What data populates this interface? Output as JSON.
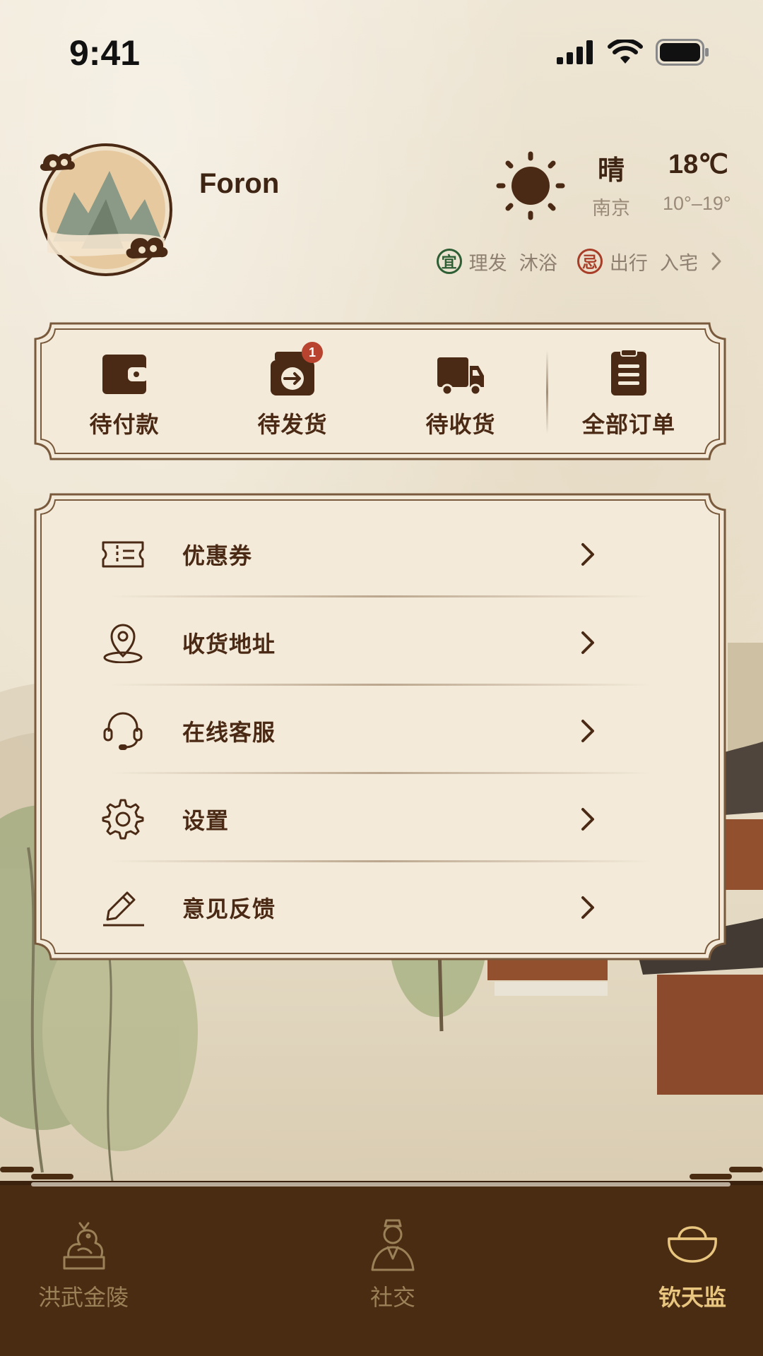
{
  "status_bar": {
    "time": "9:41"
  },
  "profile": {
    "username": "Foron"
  },
  "weather": {
    "condition": "晴",
    "temperature": "18℃",
    "city": "南京",
    "range": "10°–19°"
  },
  "almanac": {
    "yi_badge": "宜",
    "yi_items": "理发  沐浴",
    "ji_badge": "忌",
    "ji_items": "出行  入宅"
  },
  "orders": {
    "items": [
      {
        "label": "待付款",
        "icon": "wallet-icon"
      },
      {
        "label": "待发货",
        "icon": "ship-box-icon",
        "badge": "1"
      },
      {
        "label": "待收货",
        "icon": "delivery-truck-icon"
      },
      {
        "label": "全部订单",
        "icon": "order-list-icon"
      }
    ]
  },
  "menu": {
    "items": [
      {
        "label": "优惠券",
        "icon": "coupon-icon"
      },
      {
        "label": "收货地址",
        "icon": "location-pin-icon"
      },
      {
        "label": "在线客服",
        "icon": "headset-icon"
      },
      {
        "label": "设置",
        "icon": "gear-icon"
      },
      {
        "label": "意见反馈",
        "icon": "pencil-icon"
      }
    ]
  },
  "tabbar": {
    "items": [
      {
        "label": "洪武金陵",
        "icon": "dragon-icon"
      },
      {
        "label": "社交",
        "icon": "scholar-icon"
      },
      {
        "label": "钦天监",
        "icon": "gold-ingot-icon",
        "active": true
      }
    ]
  },
  "colors": {
    "accent_brown": "#4a2a14",
    "tabbar_bg": "#4a2c13",
    "active_tab": "#e9c680",
    "badge_red": "#b8432f",
    "yi_green": "#2e5e34",
    "ji_red": "#a83d28"
  }
}
